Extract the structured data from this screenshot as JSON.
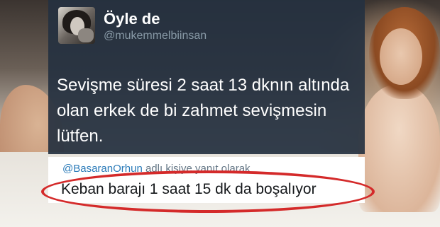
{
  "tweet": {
    "display_name": "Öyle de",
    "username": "@mukemmelbiinsan",
    "text": "Sevişme süresi 2 saat 13 dknın altında olan erkek de bi zahmet sevişmesin lütfen."
  },
  "reply": {
    "mention": "@BasaranOrhun",
    "context_suffix": " adlı kişiye yanıt olarak",
    "text": "Keban barajı 1 saat 15 dk da boşalıyor"
  },
  "colors": {
    "tweet_background": "#253140",
    "username": "#8899a6",
    "mention": "#2b7bb9",
    "highlight": "#d42a2a"
  },
  "icons": {
    "avatar": "profile-photo"
  }
}
